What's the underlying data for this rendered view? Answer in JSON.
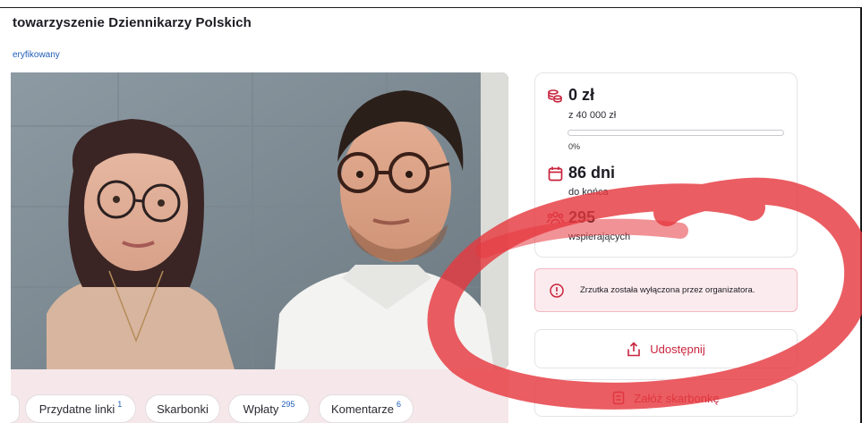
{
  "header": {
    "org_name": "towarzyszenie Dziennikarzy Polskich",
    "verified": "eryfikowany"
  },
  "campaign_photo": {
    "subject": "two people portrait, woman with glasses and man with glasses"
  },
  "tabs": [
    {
      "label": "Przydatne linki",
      "count": "1"
    },
    {
      "label": "Skarbonki",
      "count": ""
    },
    {
      "label": "Wpłaty",
      "count": "295"
    },
    {
      "label": "Komentarze",
      "count": "6"
    }
  ],
  "stats": {
    "amount": "0 zł",
    "goal": "z 40 000 zł",
    "progress": 0,
    "percent": "0%",
    "days": "86 dni",
    "days_label": "do końca",
    "supporters": "295",
    "supporters_label": "wspierających"
  },
  "alert": {
    "text": "Zrzutka została wyłączona przez organizatora."
  },
  "actions": {
    "share_label": "Udostępnij",
    "piggy_label": "Załóż skarbonkę"
  },
  "colors": {
    "accent": "#c8243d",
    "link": "#1f5db8",
    "annotation": "#e5393f"
  },
  "icons": [
    "coins-icon",
    "calendar-icon",
    "supporters-icon",
    "info-icon",
    "share-icon",
    "piggy-bank-icon"
  ]
}
